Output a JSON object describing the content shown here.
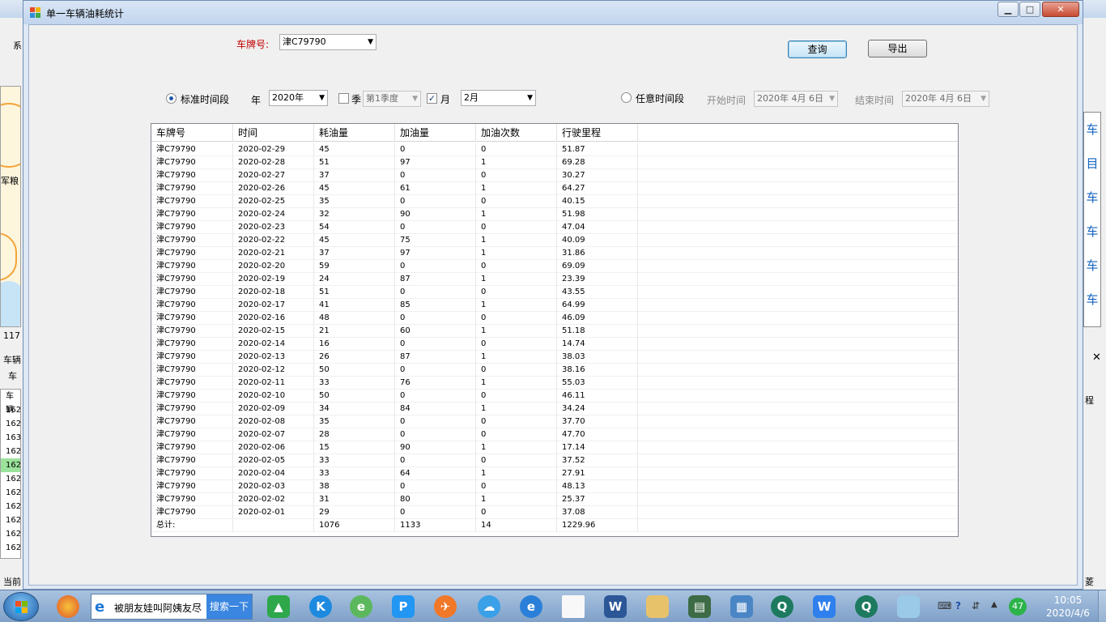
{
  "window": {
    "title": "单一车辆油耗统计",
    "minimize": "▁",
    "maximize": "□",
    "close": "✕"
  },
  "filters": {
    "plate_label": "车牌号:",
    "plate_value": "津C79790",
    "query_button": "查询",
    "export_button": "导出",
    "standard_period_label": "标准时间段",
    "year_label": "年",
    "year_value": "2020年",
    "season_label": "季",
    "season_value": "第1季度",
    "season_checked": false,
    "month_label": "月",
    "month_value": "2月",
    "month_checked": true,
    "custom_period_label": "任意时间段",
    "start_label": "开始时间",
    "start_value": "2020年 4月 6日",
    "end_label": "结束时间",
    "end_value": "2020年 4月 6日"
  },
  "table": {
    "columns": [
      "车牌号",
      "时间",
      "耗油量",
      "加油量",
      "加油次数",
      "行驶里程"
    ],
    "rows": [
      [
        "津C79790",
        "2020-02-29",
        "45",
        "0",
        "0",
        "51.87"
      ],
      [
        "津C79790",
        "2020-02-28",
        "51",
        "97",
        "1",
        "69.28"
      ],
      [
        "津C79790",
        "2020-02-27",
        "37",
        "0",
        "0",
        "30.27"
      ],
      [
        "津C79790",
        "2020-02-26",
        "45",
        "61",
        "1",
        "64.27"
      ],
      [
        "津C79790",
        "2020-02-25",
        "35",
        "0",
        "0",
        "40.15"
      ],
      [
        "津C79790",
        "2020-02-24",
        "32",
        "90",
        "1",
        "51.98"
      ],
      [
        "津C79790",
        "2020-02-23",
        "54",
        "0",
        "0",
        "47.04"
      ],
      [
        "津C79790",
        "2020-02-22",
        "45",
        "75",
        "1",
        "40.09"
      ],
      [
        "津C79790",
        "2020-02-21",
        "37",
        "97",
        "1",
        "31.86"
      ],
      [
        "津C79790",
        "2020-02-20",
        "59",
        "0",
        "0",
        "69.09"
      ],
      [
        "津C79790",
        "2020-02-19",
        "24",
        "87",
        "1",
        "23.39"
      ],
      [
        "津C79790",
        "2020-02-18",
        "51",
        "0",
        "0",
        "43.55"
      ],
      [
        "津C79790",
        "2020-02-17",
        "41",
        "85",
        "1",
        "64.99"
      ],
      [
        "津C79790",
        "2020-02-16",
        "48",
        "0",
        "0",
        "46.09"
      ],
      [
        "津C79790",
        "2020-02-15",
        "21",
        "60",
        "1",
        "51.18"
      ],
      [
        "津C79790",
        "2020-02-14",
        "16",
        "0",
        "0",
        "14.74"
      ],
      [
        "津C79790",
        "2020-02-13",
        "26",
        "87",
        "1",
        "38.03"
      ],
      [
        "津C79790",
        "2020-02-12",
        "50",
        "0",
        "0",
        "38.16"
      ],
      [
        "津C79790",
        "2020-02-11",
        "33",
        "76",
        "1",
        "55.03"
      ],
      [
        "津C79790",
        "2020-02-10",
        "50",
        "0",
        "0",
        "46.11"
      ],
      [
        "津C79790",
        "2020-02-09",
        "34",
        "84",
        "1",
        "34.24"
      ],
      [
        "津C79790",
        "2020-02-08",
        "35",
        "0",
        "0",
        "37.70"
      ],
      [
        "津C79790",
        "2020-02-07",
        "28",
        "0",
        "0",
        "47.70"
      ],
      [
        "津C79790",
        "2020-02-06",
        "15",
        "90",
        "1",
        "17.14"
      ],
      [
        "津C79790",
        "2020-02-05",
        "33",
        "0",
        "0",
        "37.52"
      ],
      [
        "津C79790",
        "2020-02-04",
        "33",
        "64",
        "1",
        "27.91"
      ],
      [
        "津C79790",
        "2020-02-03",
        "38",
        "0",
        "0",
        "48.13"
      ],
      [
        "津C79790",
        "2020-02-02",
        "31",
        "80",
        "1",
        "25.37"
      ],
      [
        "津C79790",
        "2020-02-01",
        "29",
        "0",
        "0",
        "37.08"
      ],
      [
        "总计:",
        "",
        "1076",
        "1133",
        "14",
        "1229.96"
      ]
    ]
  },
  "background_app": {
    "menu_fragment": "系",
    "map_label": "军粮",
    "map_number": "117",
    "panel_label": "车辆",
    "tab_label": "车",
    "list_header": "车辆",
    "list_items": [
      "162",
      "162",
      "163",
      "162",
      "162",
      "162",
      "162",
      "162",
      "162",
      "162",
      "162"
    ],
    "status_fragment": "当前",
    "right_chars": [
      "车",
      "目",
      "车",
      "车",
      "车",
      "车"
    ],
    "right_close": "✕",
    "right_label": "程",
    "right_bottom": "菱"
  },
  "taskbar": {
    "search_text": "被朋友娃叫阿姨友尽",
    "search_button": "搜索一下",
    "notification_count": "47",
    "time": "10:05",
    "date": "2020/4/6"
  },
  "colors": {
    "required_label": "#c00000",
    "accent": "#1e5aa8"
  }
}
